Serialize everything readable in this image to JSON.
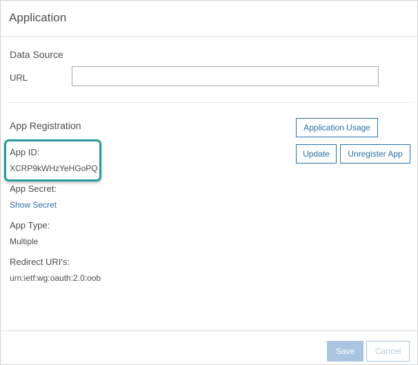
{
  "dialog": {
    "title": "Application"
  },
  "data_source": {
    "title": "Data Source",
    "url_label": "URL",
    "url_value": "",
    "url_placeholder": ""
  },
  "app_registration": {
    "title": "App Registration",
    "app_id_label": "App ID:",
    "app_id_value": "XCRP9kWHzYeHGoPQ",
    "app_secret_label": "App Secret:",
    "show_secret_link": "Show Secret",
    "app_type_label": "App Type:",
    "app_type_value": "Multiple",
    "redirect_label": "Redirect URI's:",
    "redirect_value": "urn:ietf:wg:oauth:2.0:oob"
  },
  "buttons": {
    "application_usage": "Application Usage",
    "update": "Update",
    "unregister": "Unregister App",
    "save": "Save",
    "cancel": "Cancel"
  },
  "colors": {
    "accent": "#2a6fa8",
    "highlight": "#2a9a9a",
    "disabled_primary": "#a9c5e0"
  }
}
